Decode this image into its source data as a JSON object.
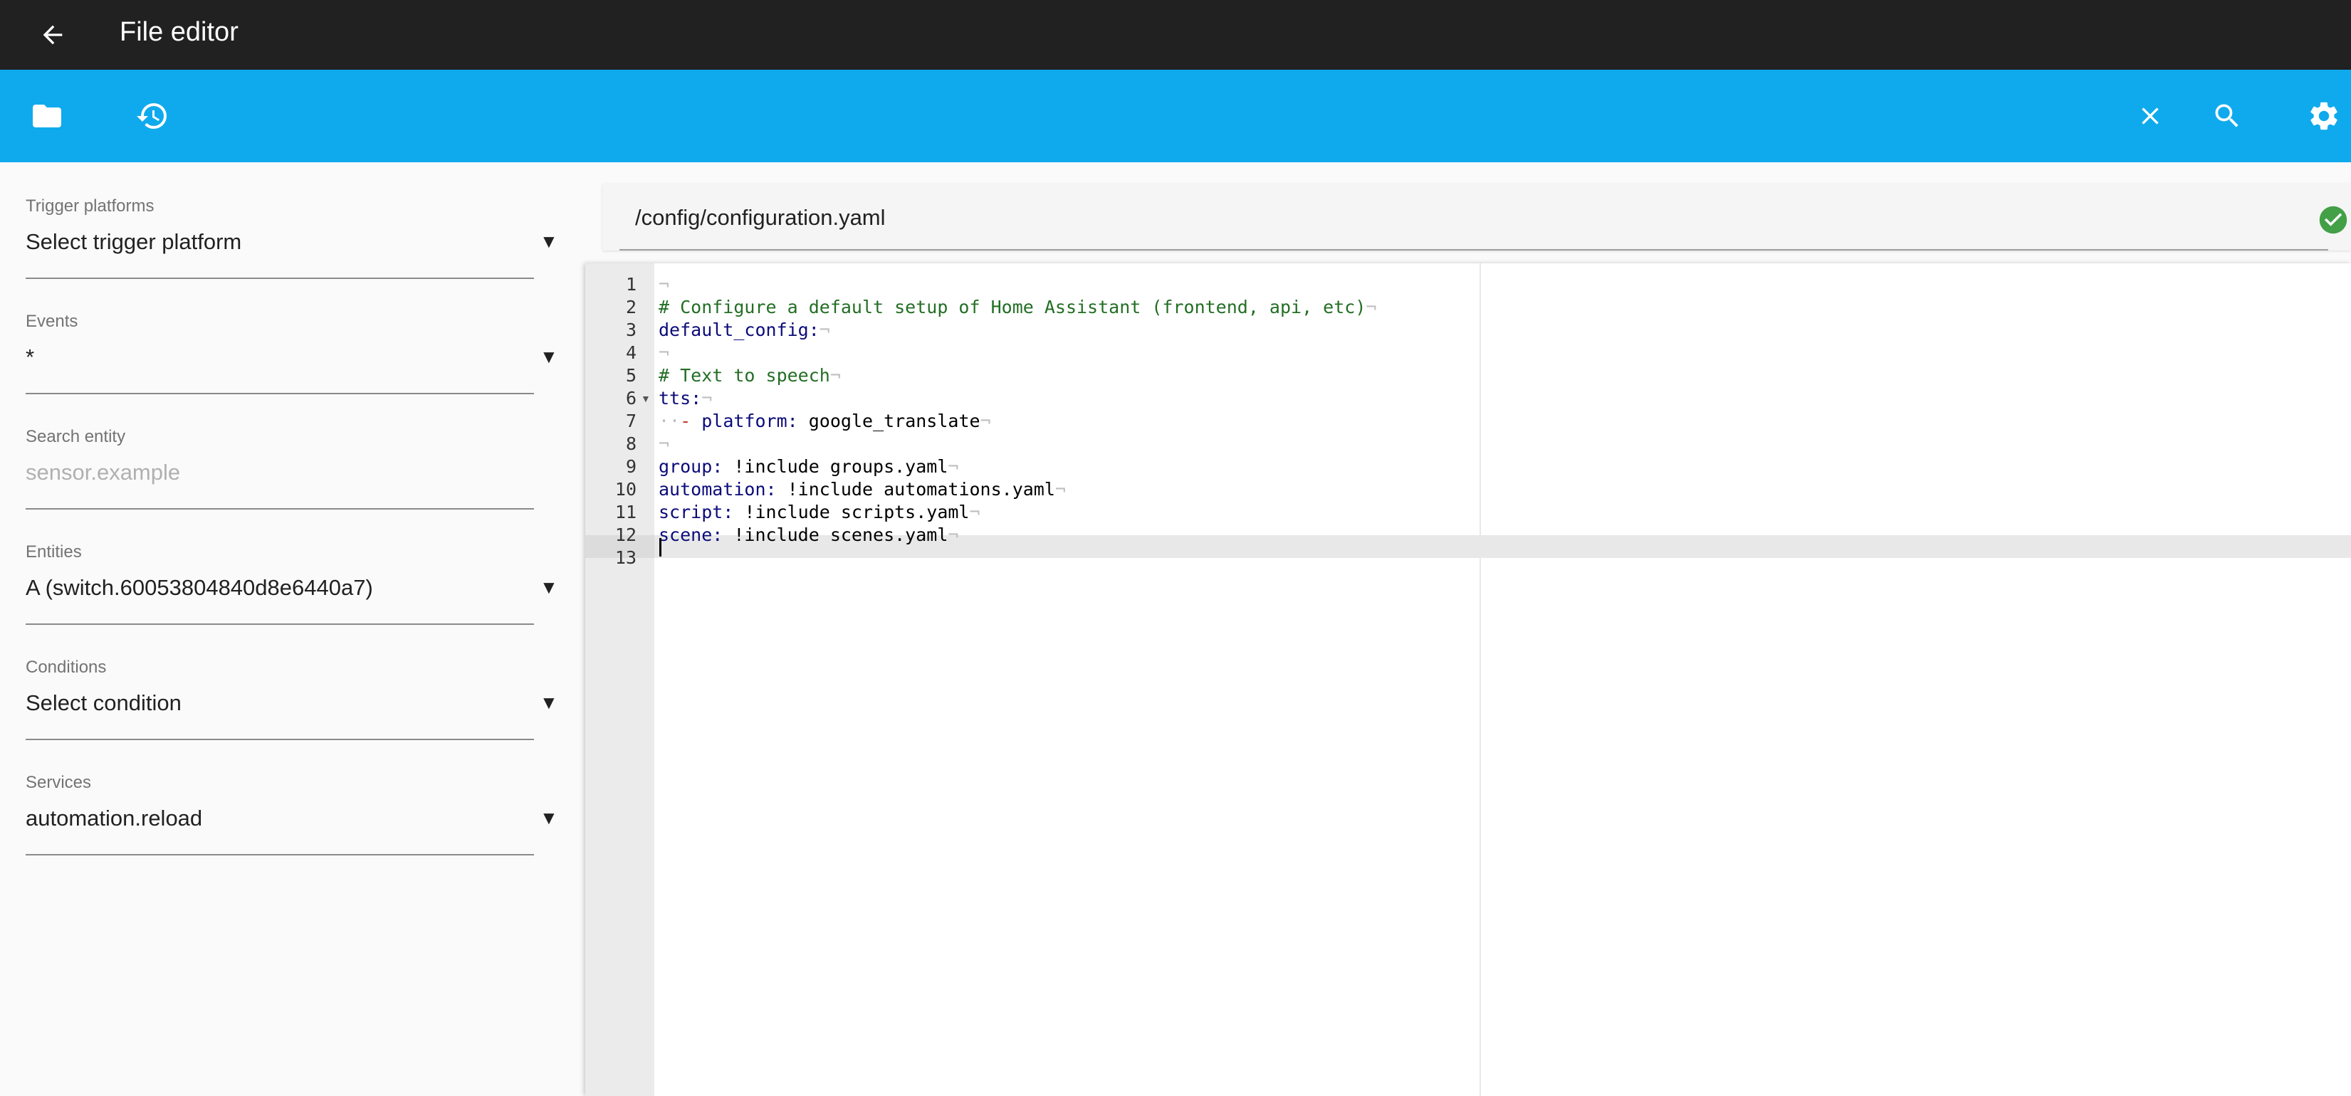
{
  "header": {
    "title": "File editor",
    "back_icon": "arrow-left-icon"
  },
  "toolbar": {
    "left_icons": [
      "folder-icon",
      "history-icon"
    ],
    "right_icons": [
      "close-icon",
      "search-icon",
      "gear-icon"
    ],
    "background": "#0faaed"
  },
  "sidebar": {
    "trigger_platforms": {
      "label": "Trigger platforms",
      "value": "Select trigger platform"
    },
    "events": {
      "label": "Events",
      "value": "*"
    },
    "search_entity": {
      "label": "Search entity",
      "placeholder": "sensor.example"
    },
    "entities": {
      "label": "Entities",
      "value": "A (switch.60053804840d8e6440a7)"
    },
    "conditions": {
      "label": "Conditions",
      "value": "Select condition"
    },
    "services": {
      "label": "Services",
      "value": "automation.reload"
    }
  },
  "editor": {
    "file_path": "/config/configuration.yaml",
    "saved_icon": "check-circle-icon",
    "line_numbers": [
      "1",
      "2",
      "3",
      "4",
      "5",
      "6",
      "7",
      "8",
      "9",
      "10",
      "11",
      "12",
      "13"
    ],
    "lines": {
      "l2_comment": "# Configure a default setup of Home Assistant (frontend, api, etc)",
      "l3_key": "default_config:",
      "l5_comment": "# Text to speech",
      "l6_key": "tts:",
      "l7_dash": "- ",
      "l7_key": "platform:",
      "l7_value": " google_translate",
      "l9_key": "group:",
      "l9_value": " !include groups.yaml",
      "l10_key": "automation:",
      "l10_value": " !include automations.yaml",
      "l11_key": "script:",
      "l11_value": " !include scripts.yaml",
      "l12_key": "scene:",
      "l12_value": " !include scenes.yaml"
    },
    "active_line": 13
  }
}
